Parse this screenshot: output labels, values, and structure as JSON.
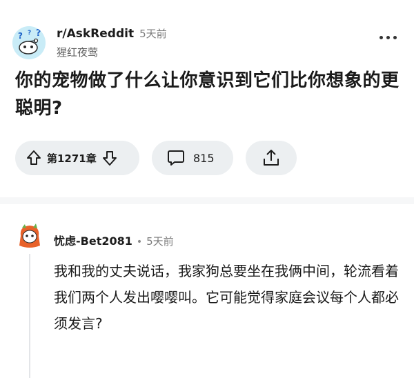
{
  "post": {
    "subreddit": "r/AskReddit",
    "time": "5天前",
    "author": "猩红夜莺",
    "title": "你的宠物做了什么让你意识到它们比你想象的更聪明?",
    "vote_count": "第1271章",
    "comment_count": "815"
  },
  "comment": {
    "author": "忧虑-Bet2081",
    "separator": "•",
    "time": "5天前",
    "body": "我和我的丈夫说话，我家狗总要坐在我俩中间，轮流看着我们两个人发出嘤嘤叫。它可能觉得家庭会议每个人都必须发言?"
  },
  "icons": {
    "more": "more-dots-icon",
    "upvote": "upvote-arrow-icon",
    "downvote": "downvote-arrow-icon",
    "comment": "comment-bubble-icon",
    "share": "share-icon"
  },
  "colors": {
    "pill_bg": "#eceff1",
    "subreddit_avatar_bg": "#c9ecf7",
    "comment_avatar_accent": "#e8622a"
  }
}
